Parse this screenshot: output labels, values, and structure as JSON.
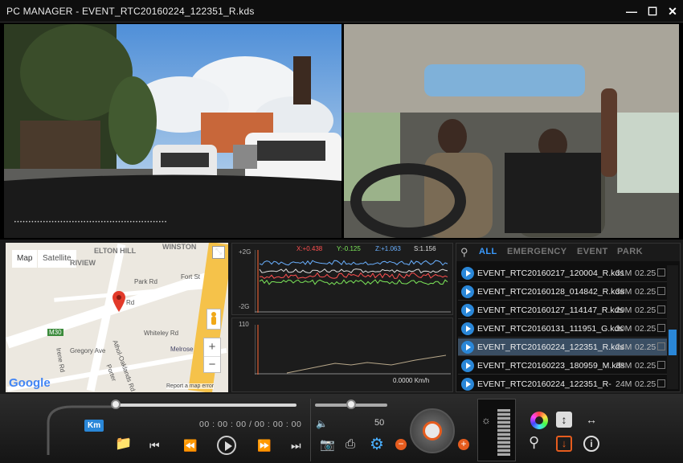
{
  "window": {
    "title": "PC MANAGER - EVENT_RTC20160224_122351_R.kds"
  },
  "map": {
    "tab_map": "Map",
    "tab_satellite": "Satellite",
    "labels": [
      "ELTON HILL",
      "WINSTON",
      "RIVIEW",
      "Park Rd",
      "Fort St",
      "Whiteley Rd",
      "Gregory Ave",
      "Melrose",
      "M30",
      "Athol-Oaklands Rd",
      "Porter",
      "Irene Rd",
      "Rd"
    ],
    "google": "Google",
    "error_link": "Report a map error",
    "zoom_in": "+",
    "zoom_out": "−"
  },
  "gsensor": {
    "x_label": "X:+0.438",
    "y_label": "Y:-0.125",
    "z_label": "Z:+1.063",
    "s_label": "S:1.156",
    "top_tick": "+2G",
    "bottom_tick": "-2G",
    "colors": {
      "x": "#ff5050",
      "y": "#7de85a",
      "z": "#6ab0ff",
      "s": "#dddddd"
    }
  },
  "speed": {
    "top_tick": "110",
    "readout": "0.0000 Km/h",
    "line_color": "#b8a88a"
  },
  "files": {
    "tabs": [
      "ALL",
      "EMERGENCY",
      "EVENT",
      "PARK"
    ],
    "rows": [
      {
        "name": "EVENT_RTC20160217_120004_R.kds",
        "size": "31M",
        "date": "02.25"
      },
      {
        "name": "EVENT_RTC20160128_014842_R.kds",
        "size": "38M",
        "date": "02.25"
      },
      {
        "name": "EVENT_RTC20160127_114147_R.kds",
        "size": "29M",
        "date": "02.25"
      },
      {
        "name": "EVENT_RTC20160131_111951_G.kds",
        "size": "30M",
        "date": "02.25"
      },
      {
        "name": "EVENT_RTC20160224_122351_R.kds",
        "size": "24M",
        "date": "02.25"
      },
      {
        "name": "EVENT_RTC20160223_180959_M.kds",
        "size": "38M",
        "date": "02.25"
      },
      {
        "name": "EVENT_RTC20160224_122351_R-",
        "size": "24M",
        "date": "02.25"
      }
    ],
    "selected_index": 4
  },
  "controls": {
    "unit": "Km",
    "time": "00 : 00 : 00 / 00 : 00 : 00",
    "volume": "50",
    "playback_progress": 0,
    "volume_level": 0.5
  }
}
